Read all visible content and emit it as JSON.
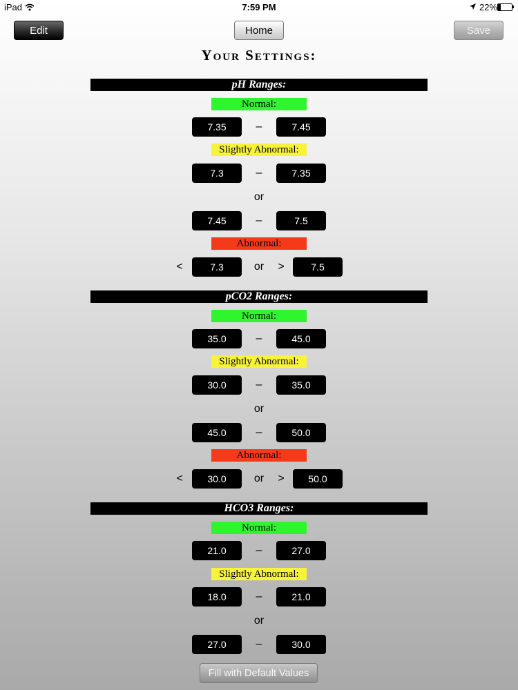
{
  "status_bar": {
    "device": "iPad",
    "time": "7:59 PM",
    "battery": "22%"
  },
  "nav": {
    "edit": "Edit",
    "home": "Home",
    "save": "Save"
  },
  "page_title": "Your Settings:",
  "dash": "–",
  "or": "or",
  "lt": "<",
  "gt": ">",
  "labels": {
    "normal": "Normal:",
    "slight": "Slightly Abnormal:",
    "abnormal": "Abnormal:"
  },
  "ph": {
    "title": "pH Ranges:",
    "normal": [
      "7.35",
      "7.45"
    ],
    "slight_low": [
      "7.3",
      "7.35"
    ],
    "slight_high": [
      "7.45",
      "7.5"
    ],
    "abnormal": [
      "7.3",
      "7.5"
    ]
  },
  "pco2": {
    "title": "pCO2 Ranges:",
    "normal": [
      "35.0",
      "45.0"
    ],
    "slight_low": [
      "30.0",
      "35.0"
    ],
    "slight_high": [
      "45.0",
      "50.0"
    ],
    "abnormal": [
      "30.0",
      "50.0"
    ]
  },
  "hco3": {
    "title": "HCO3 Ranges:",
    "normal": [
      "21.0",
      "27.0"
    ],
    "slight_low": [
      "18.0",
      "21.0"
    ],
    "slight_high": [
      "27.0",
      "30.0"
    ]
  },
  "fill_button": "Fill with Default Values"
}
